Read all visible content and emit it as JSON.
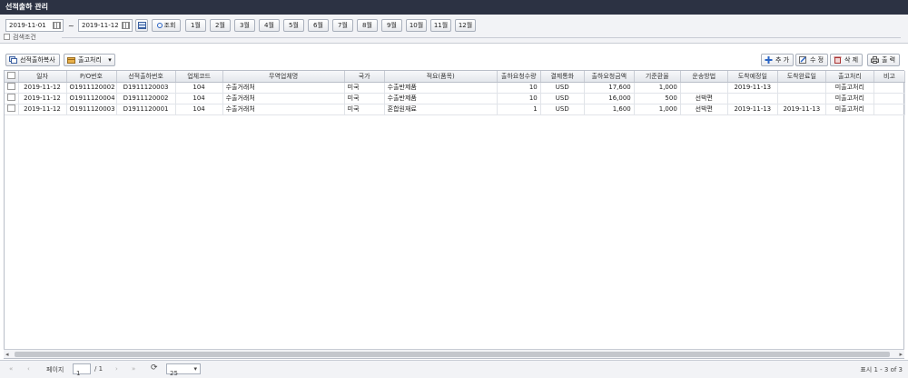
{
  "window": {
    "title": "선적출하 관리"
  },
  "filter": {
    "date_from": "2019-11-01",
    "date_to": "2019-11-12",
    "tilde": "~",
    "search_label": "조회",
    "months": [
      "1월",
      "2월",
      "3월",
      "4월",
      "5월",
      "6월",
      "7월",
      "8월",
      "9월",
      "10월",
      "11월",
      "12월"
    ],
    "search_condition_label": "검색조건"
  },
  "toolbar": {
    "copy_label": "선적출하복사",
    "release_label": "출고처리",
    "add_label": "추 가",
    "edit_label": "수 정",
    "delete_label": "삭 제",
    "print_label": "출 력"
  },
  "table": {
    "headers": [
      "일자",
      "P/O번호",
      "선적출하번호",
      "업체코드",
      "무역업체명",
      "국가",
      "적요(품목)",
      "출하요청수량",
      "결제통화",
      "출하요청금액",
      "기준환율",
      "운송방법",
      "도착예정일",
      "도착완료일",
      "출고처리",
      "비고"
    ],
    "rows": [
      [
        "2019-11-12",
        "O1911120002",
        "D1911120003",
        "104",
        "수출거래처",
        "미국",
        "수출반제품",
        "10",
        "USD",
        "17,600",
        "1,000",
        "",
        "2019-11-13",
        "",
        "미출고처리",
        ""
      ],
      [
        "2019-11-12",
        "O1911120004",
        "D1911120002",
        "104",
        "수출거래처",
        "미국",
        "수출반제품",
        "10",
        "USD",
        "16,000",
        "500",
        "선박편",
        "",
        "",
        "미출고처리",
        ""
      ],
      [
        "2019-11-12",
        "O1911120003",
        "D1911120001",
        "104",
        "수출거래처",
        "미국",
        "혼합원재료",
        "1",
        "USD",
        "1,600",
        "1,000",
        "선박편",
        "2019-11-13",
        "2019-11-13",
        "미출고처리",
        ""
      ]
    ]
  },
  "pager": {
    "page_label": "페이지",
    "page_value": "1",
    "page_total": "/ 1",
    "page_size": "25",
    "summary": "표시 1 - 3 of 3"
  },
  "colors": {
    "titlebar": "#2c3243",
    "accent": "#2a64c4"
  },
  "icons": {
    "first": "«",
    "prev": "‹",
    "next": "›",
    "last": "»",
    "refresh": "⟳",
    "dropdown": "▾",
    "scroll_left": "◂",
    "scroll_right": "▸"
  }
}
